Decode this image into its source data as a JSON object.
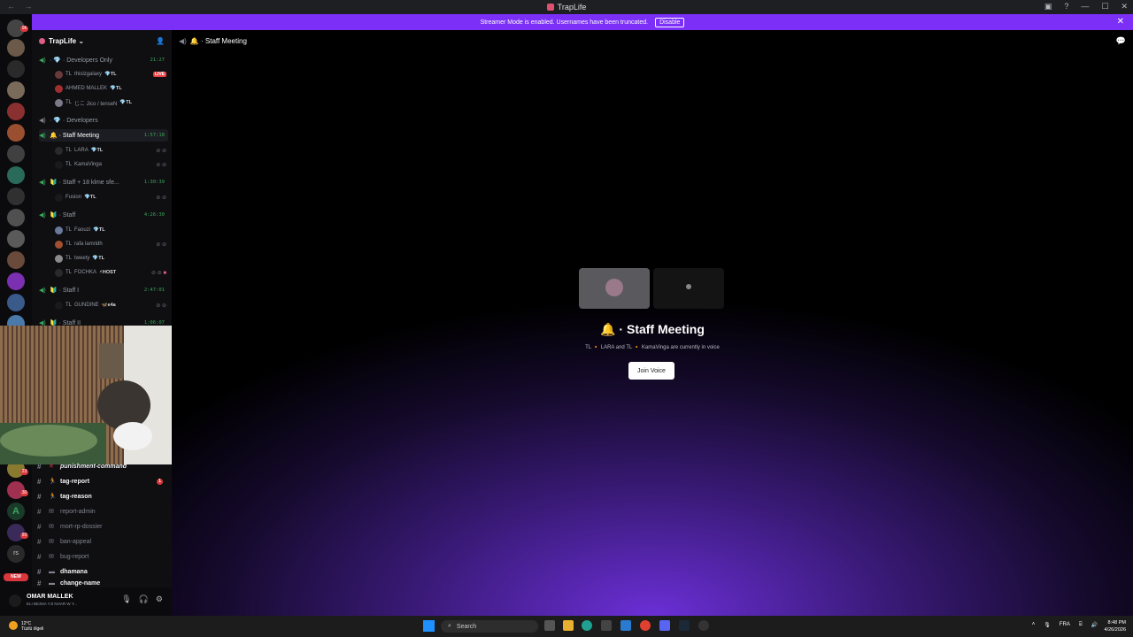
{
  "window": {
    "title": "TrapLife",
    "nav": "← →"
  },
  "banner": {
    "text": "Streamer Mode is enabled. Usernames have been truncated.",
    "action": "Disable"
  },
  "guild": {
    "name": "TrapLife ⌄"
  },
  "voice_channels": [
    {
      "name": "· 💎 · Developers Only",
      "time": "21:27"
    },
    {
      "name": "· 💎 · Developers",
      "time": ""
    },
    {
      "name": "🔔 · Staff Meeting",
      "time": "1:57:18"
    },
    {
      "name": "🔰 · Staff + 18 klme sfe...",
      "time": "1:30:39"
    },
    {
      "name": "🔰 · Staff",
      "time": "4:26:30"
    },
    {
      "name": "🔰 · Staff I",
      "time": "2:47:01"
    },
    {
      "name": "🔰 · Staff II",
      "time": "1:06:07"
    }
  ],
  "voice_users": [
    {
      "prefix": "TL",
      "name": "thislzgalaxy",
      "tag": "💎TL",
      "live": "LIVE"
    },
    {
      "prefix": "",
      "name": "AHMED MALLEK",
      "tag": "💎TL"
    },
    {
      "prefix": "TL",
      "name": "じこ Jico / tenseN",
      "tag": "💎TL"
    },
    {
      "prefix": "TL",
      "name": "LARA",
      "tag": "💎TL"
    },
    {
      "prefix": "TL",
      "name": "KamaVinga",
      "tag": ""
    },
    {
      "prefix": "",
      "name": "Fusion",
      "tag": "💎TL"
    },
    {
      "prefix": "TL",
      "name": "Faouzi",
      "tag": "💎TL"
    },
    {
      "prefix": "TL",
      "name": "rafa lamridh",
      "tag": ""
    },
    {
      "prefix": "TL",
      "name": "tweety",
      "tag": "💎TL"
    },
    {
      "prefix": "TL",
      "name": "FOCHKA",
      "tag": "⚡HOST"
    },
    {
      "prefix": "TL",
      "name": "GUNDINE",
      "tag": "🦋e4a"
    }
  ],
  "text_channels": [
    {
      "name": "punishment-command",
      "icon": "✕"
    },
    {
      "name": "tag-report",
      "icon": "🏃",
      "unread": "1"
    },
    {
      "name": "tag-reason",
      "icon": "🏃"
    },
    {
      "name": "report-admin",
      "icon": "✉"
    },
    {
      "name": "mort-rp-dossier",
      "icon": "✉"
    },
    {
      "name": "ban-appeal",
      "icon": "✉"
    },
    {
      "name": "bug-report",
      "icon": "✉"
    },
    {
      "name": "dhamana",
      "icon": "▬"
    },
    {
      "name": "change-name",
      "icon": "▬"
    }
  ],
  "user_panel": {
    "name": "OMAR MALLEK",
    "status": "ELI BE3NA YJI NHAR W Y..."
  },
  "header": {
    "channel": "🔔 · Staff Meeting"
  },
  "meeting": {
    "title": "🔔 · Staff Meeting",
    "subtitle": "TL 🔸 LARA and TL 🔸 KamaVinga are currently in voice",
    "join": "Join Voice"
  },
  "taskbar": {
    "weather_temp": "12°C",
    "weather_desc": "Tüzlü ölgeli",
    "search": "Search",
    "lang": "FRA",
    "time": "8:48 PM",
    "date": "4/26/2026"
  },
  "rail_badges": [
    "9k",
    "1",
    "1",
    "1",
    "1",
    "1",
    "23",
    "30",
    "93"
  ],
  "server_letters": {
    "a": "A",
    "rs": "rs",
    "new": "NEW"
  },
  "colors": {
    "banner": "#7b2ff7",
    "online": "#3ba55c",
    "mention": "#da373c"
  }
}
